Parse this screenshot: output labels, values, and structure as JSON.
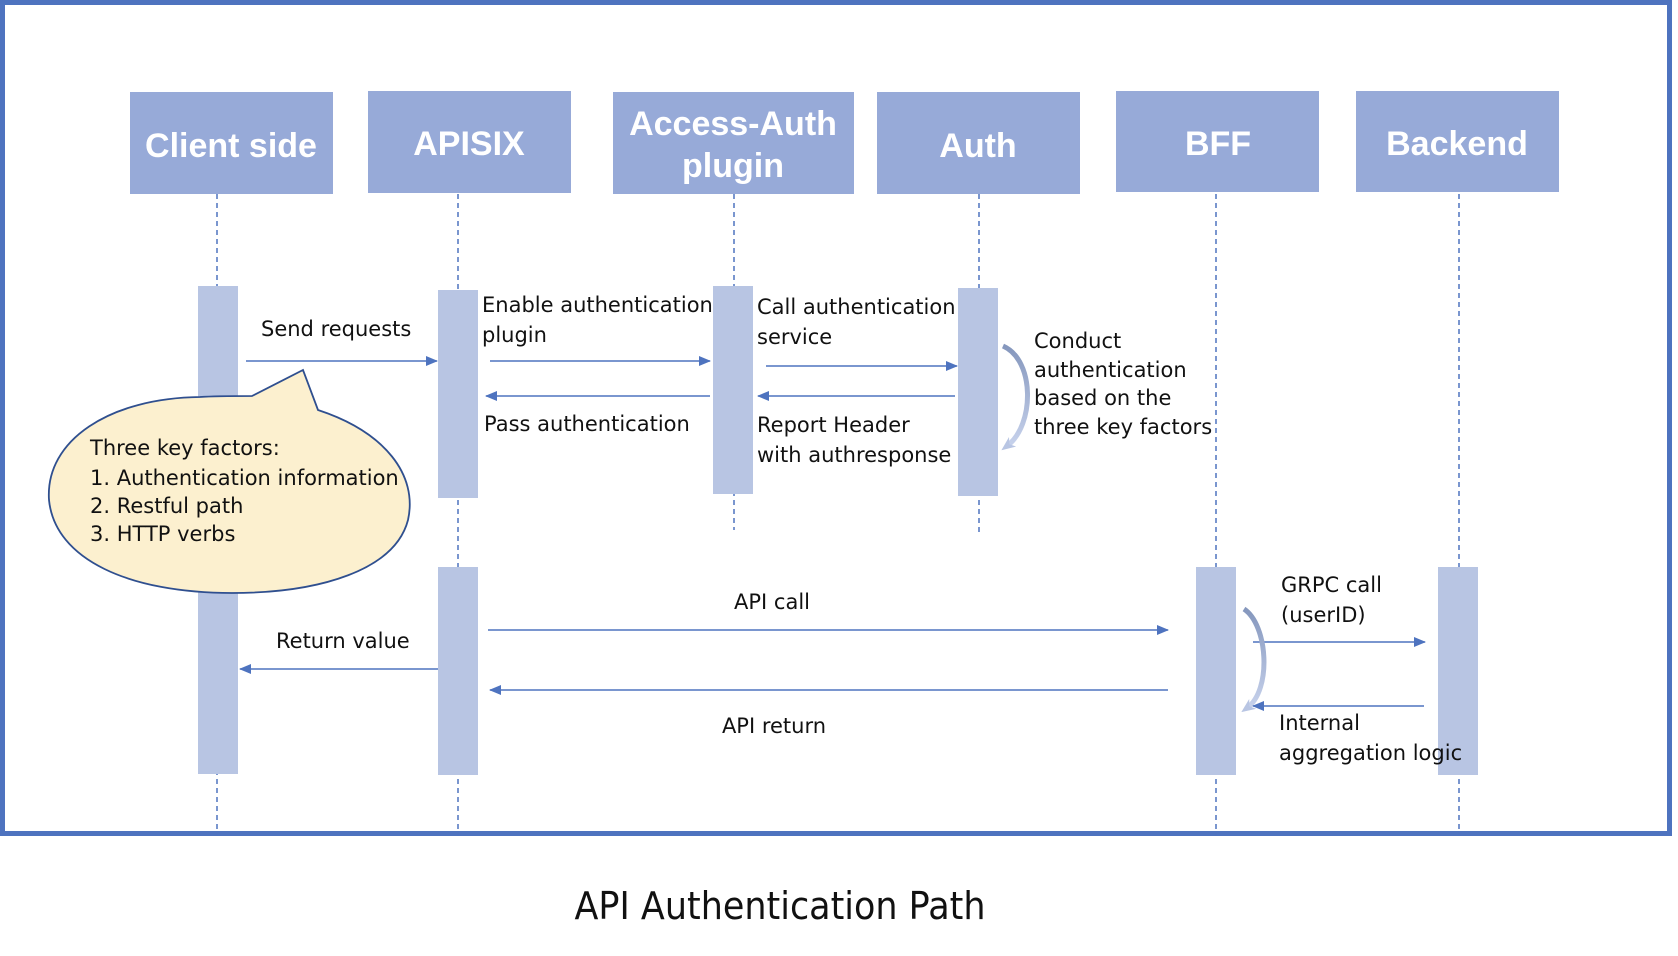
{
  "caption": "API Authentication Path",
  "colors": {
    "frame": "#4e73bf",
    "header_fill": "#97aad8",
    "activation_fill": "#b8c5e3",
    "arrow": "#4e73bf",
    "note_fill": "#fcf0cf",
    "note_stroke": "#2f4f8f"
  },
  "participants": [
    {
      "id": "client",
      "label": [
        "Client side"
      ]
    },
    {
      "id": "apisix",
      "label": [
        "APISIX"
      ]
    },
    {
      "id": "plugin",
      "label": [
        "Access-Auth",
        "plugin"
      ]
    },
    {
      "id": "auth",
      "label": [
        "Auth"
      ]
    },
    {
      "id": "bff",
      "label": [
        "BFF"
      ]
    },
    {
      "id": "backend",
      "label": [
        "Backend"
      ]
    }
  ],
  "messages": [
    {
      "from": "client",
      "to": "apisix",
      "label": [
        "Send requests"
      ]
    },
    {
      "from": "apisix",
      "to": "plugin",
      "label": [
        "Enable authentication",
        "plugin"
      ]
    },
    {
      "from": "plugin",
      "to": "apisix",
      "label": [
        "Pass authentication"
      ]
    },
    {
      "from": "plugin",
      "to": "auth",
      "label": [
        "Call authentication",
        "service"
      ]
    },
    {
      "from": "auth",
      "to": "plugin",
      "label": [
        "Report Header",
        "with authresponse"
      ]
    },
    {
      "from": "auth",
      "to": "auth",
      "label": [
        "Conduct",
        "authentication",
        "based on the",
        "three key factors"
      ]
    },
    {
      "from": "apisix",
      "to": "bff",
      "label": [
        "API call"
      ]
    },
    {
      "from": "bff",
      "to": "apisix",
      "label": [
        "API return"
      ]
    },
    {
      "from": "apisix",
      "to": "client",
      "label": [
        "Return value"
      ]
    },
    {
      "from": "bff",
      "to": "backend",
      "label": [
        "GRPC call",
        "(userID)"
      ]
    },
    {
      "from": "backend",
      "to": "bff",
      "label": [
        "Internal",
        "aggregation logic"
      ]
    }
  ],
  "note": {
    "lines": [
      "Three key factors:",
      "1. Authentication information",
      "2. Restful path",
      "3. HTTP verbs"
    ]
  }
}
